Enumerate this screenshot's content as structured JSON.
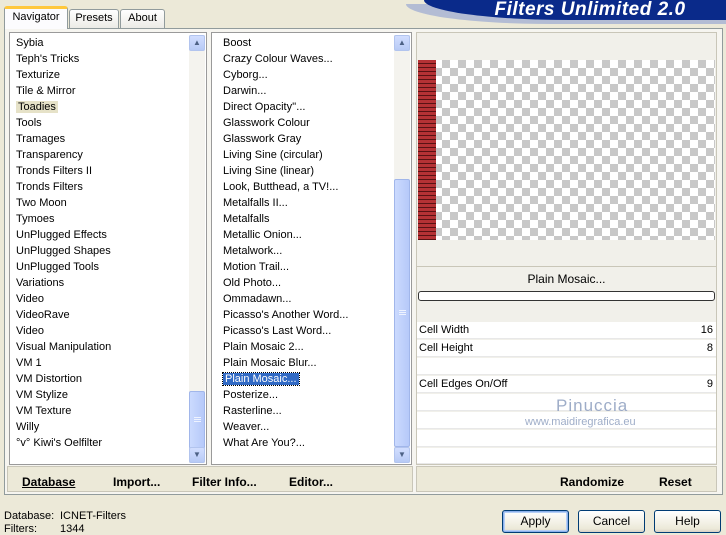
{
  "tabs": [
    {
      "label": "Navigator",
      "active": true
    },
    {
      "label": "Presets",
      "active": false
    },
    {
      "label": "About",
      "active": false
    }
  ],
  "title": "Filters Unlimited 2.0",
  "categories": [
    "Sybia",
    "Teph's Tricks",
    "Texturize",
    "Tile & Mirror",
    "Toadies",
    "Tools",
    "Tramages",
    "Transparency",
    "Tronds Filters II",
    "Tronds Filters",
    "Two Moon",
    "Tymoes",
    "UnPlugged Effects",
    "UnPlugged Shapes",
    "UnPlugged Tools",
    "Variations",
    "Video",
    "VideoRave",
    "Video",
    "Visual Manipulation",
    "VM 1",
    "VM Distortion",
    "VM Stylize",
    "VM Texture",
    "Willy",
    "°v° Kiwi's Oelfilter"
  ],
  "categories_selected": "Toadies",
  "filters": [
    "Boost",
    "Crazy Colour Waves...",
    "Cyborg...",
    "Darwin...",
    "Direct Opacity''...",
    "Glasswork Colour",
    "Glasswork Gray",
    "Living Sine (circular)",
    "Living Sine (linear)",
    "Look, Butthead, a TV!...",
    "Metalfalls II...",
    "Metalfalls",
    "Metallic Onion...",
    "Metalwork...",
    "Motion Trail...",
    "Old Photo...",
    "Ommadawn...",
    "Picasso's Another Word...",
    "Picasso's Last Word...",
    "Plain Mosaic 2...",
    "Plain Mosaic Blur...",
    "Plain Mosaic...",
    "Posterize...",
    "Rasterline...",
    "Weaver...",
    "What Are You?..."
  ],
  "filters_selected": "Plain Mosaic...",
  "list_buttons": {
    "database": "Database",
    "import": "Import...",
    "filter_info": "Filter Info...",
    "editor": "Editor..."
  },
  "filter_name": "Plain Mosaic...",
  "params": [
    {
      "label": "Cell Width",
      "value": "16"
    },
    {
      "label": "Cell Height",
      "value": "8"
    },
    {
      "label": "Cell Edges On/Off",
      "value": "9"
    }
  ],
  "watermark": {
    "name": "Pinuccia",
    "url": "www.maidiregrafica.eu"
  },
  "right_buttons": {
    "randomize": "Randomize",
    "reset": "Reset"
  },
  "status": {
    "database_label": "Database:",
    "database_value": "ICNET-Filters",
    "filters_label": "Filters:",
    "filters_value": "1344"
  },
  "dialog_buttons": {
    "apply": "Apply",
    "cancel": "Cancel",
    "help": "Help"
  },
  "colors": {
    "selection": "#316ac5",
    "banner": "#0a2a8a",
    "preview_strip": "#b53235"
  }
}
